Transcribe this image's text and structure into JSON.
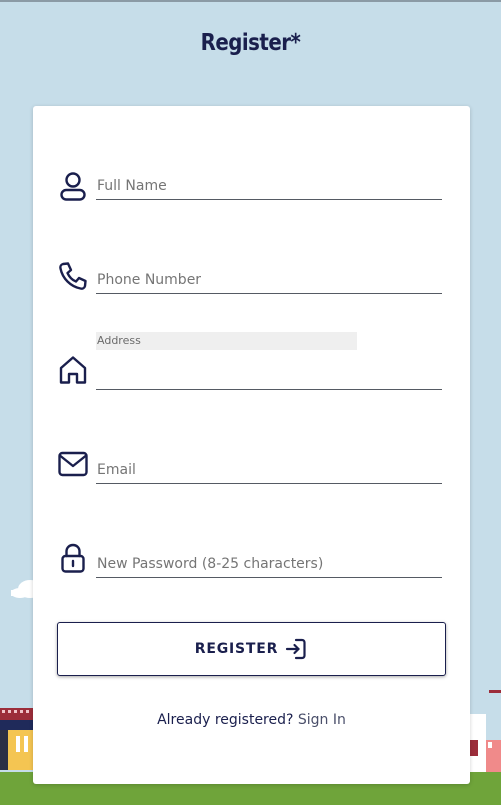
{
  "page": {
    "title": "Register*"
  },
  "form": {
    "full_name": {
      "placeholder": "Full Name",
      "value": "",
      "icon": "user-icon"
    },
    "phone": {
      "placeholder": "Phone Number",
      "value": "",
      "icon": "phone-icon"
    },
    "address": {
      "label": "Address",
      "value": "",
      "icon": "home-icon"
    },
    "email": {
      "placeholder": "Email",
      "value": "",
      "icon": "mail-icon"
    },
    "password": {
      "placeholder": "New Password (8-25 characters)",
      "value": "",
      "icon": "lock-icon"
    }
  },
  "register_button": {
    "label": "REGISTER",
    "icon": "sign-in-arrow-icon"
  },
  "footer": {
    "prompt": "Already registered?",
    "link": "Sign In"
  },
  "colors": {
    "background": "#c6dde9",
    "ink": "#1a1f4d",
    "grass": "#6fa43a",
    "card": "#ffffff"
  }
}
